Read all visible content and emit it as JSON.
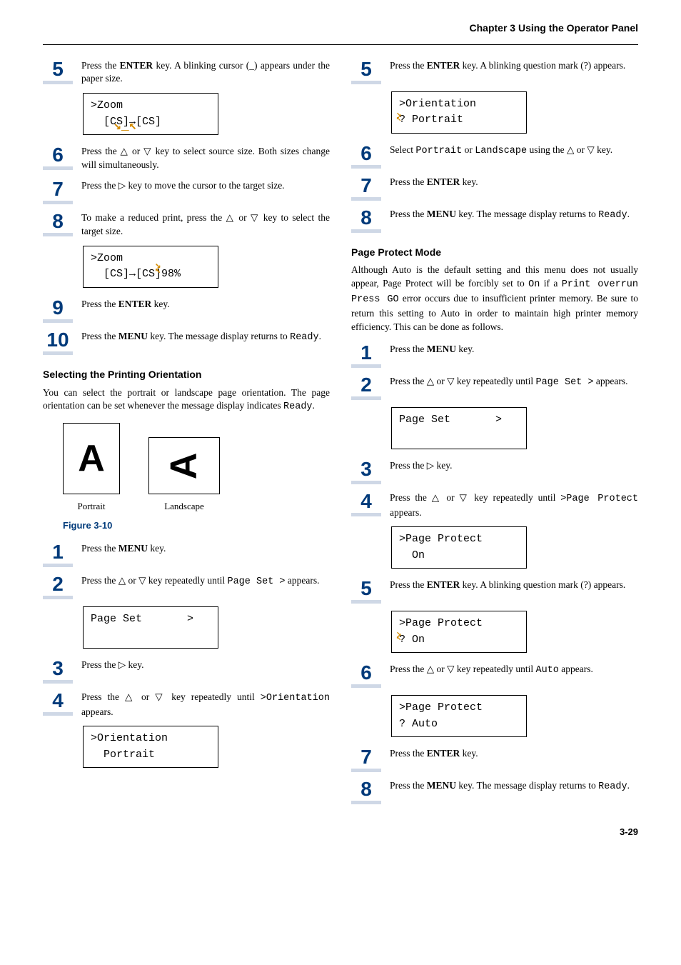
{
  "header": "Chapter 3  Using the Operator Panel",
  "left": {
    "s5": "Press the <b>ENTER</b> key. A blinking cursor (_) appears under the paper size.",
    "lcd5": {
      "l1": ">Zoom",
      "l2": "  [CS]→[CS]"
    },
    "s6": "Press the △ or ▽ key to select source size. Both sizes change will simultaneously.",
    "s7": "Press the ▷ key to move the cursor to the target size.",
    "s8": "To make a reduced print, press the △ or ▽ key to select the target size.",
    "lcd8": {
      "l1": ">Zoom",
      "l2": "  [CS]→[CS]98%"
    },
    "s9": "Press the <b>ENTER</b> key.",
    "s10": "Press the <b>MENU</b> key. The message display returns to <span class='mono'>Ready</span>.",
    "sub1": "Selecting the Printing Orientation",
    "body1": "You can select the portrait or landscape page orientation. The page orientation can be set whenever the message display indicates <span class='mono'>Ready</span>.",
    "portrait": "Portrait",
    "landscape": "Landscape",
    "fig": "Figure 3-10",
    "o1": "Press the <b>MENU</b> key.",
    "o2": "Press the △ or ▽ key repeatedly until <span class='mono'>Page Set &gt;</span> appears.",
    "lcdO2": {
      "l1": "Page Set       >",
      "l2": " "
    },
    "o3": "Press the ▷ key.",
    "o4": "Press the △ or ▽ key repeatedly until <span class='mono'>&gt;Orientation</span> appears.",
    "lcdO4": {
      "l1": ">Orientation",
      "l2": "  Portrait"
    }
  },
  "right": {
    "s5": "Press the <b>ENTER</b> key. A blinking question mark (?) appears.",
    "lcd5": {
      "l1": ">Orientation",
      "l2": "? Portrait"
    },
    "s6": "Select <span class='mono'>Portrait</span> or <span class='mono'>Landscape</span> using the △ or ▽ key.",
    "s7": "Press the <b>ENTER</b> key.",
    "s8": "Press the <b>MENU</b> key. The message display returns to <span class='mono'>Ready</span>.",
    "sub1": "Page Protect Mode",
    "body1": "Although Auto is the default setting and this menu does not usually appear, Page Protect will be forcibly set to <span class='mono'>On</span> if a <span class='mono'>Print overrun Press GO</span> error occurs due to insufficient printer memory. Be sure to return this setting to Auto in order to maintain high printer memory efficiency. This can be done as follows.",
    "p1": "Press the <b>MENU</b> key.",
    "p2": "Press the △ or ▽ key repeatedly until <span class='mono'>Page Set &gt;</span> appears.",
    "lcdP2": {
      "l1": "Page Set       >",
      "l2": " "
    },
    "p3": "Press the ▷ key.",
    "p4": "Press the △ or ▽ key repeatedly until <span class='mono'>&gt;Page Protect</span> appears.",
    "lcdP4": {
      "l1": ">Page Protect",
      "l2": "  On"
    },
    "p5": "Press the <b>ENTER</b> key. A blinking question mark (?) appears.",
    "lcdP5": {
      "l1": ">Page Protect",
      "l2": "? On"
    },
    "p6": "Press the △ or ▽ key repeatedly until <span class='mono'>Auto</span> appears.",
    "lcdP6": {
      "l1": ">Page Protect",
      "l2": "? Auto"
    },
    "p7": "Press the <b>ENTER</b> key.",
    "p8": "Press the <b>MENU</b> key. The message display returns to <span class='mono'>Ready</span>."
  },
  "pagenum": "3-29"
}
